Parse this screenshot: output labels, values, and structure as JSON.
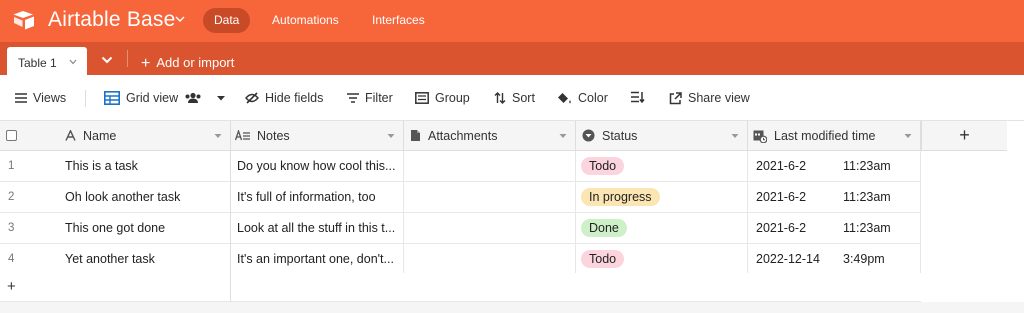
{
  "app": {
    "base_title": "Airtable Base",
    "brand_color": "#f7653b",
    "nav": [
      {
        "label": "Data",
        "active": true
      },
      {
        "label": "Automations",
        "active": false
      },
      {
        "label": "Interfaces",
        "active": false
      }
    ]
  },
  "tables": {
    "active_table": "Table 1",
    "add_label": "Add or import"
  },
  "toolbar": {
    "views": "Views",
    "grid_view": "Grid view",
    "hide_fields": "Hide fields",
    "filter": "Filter",
    "group": "Group",
    "sort": "Sort",
    "color": "Color",
    "share_view": "Share view"
  },
  "grid": {
    "columns": [
      {
        "label": "Name",
        "icon": "text-a-icon"
      },
      {
        "label": "Notes",
        "icon": "long-text-icon"
      },
      {
        "label": "Attachments",
        "icon": "attachment-icon"
      },
      {
        "label": "Status",
        "icon": "single-select-icon"
      },
      {
        "label": "Last modified time",
        "icon": "calendar-time-icon"
      }
    ],
    "add_column": "+",
    "add_row": "+",
    "rows": [
      {
        "num": "1",
        "name": "This is a task",
        "notes": "Do you know how cool this...",
        "attachments": "",
        "status": "Todo",
        "status_color": "#fbd4de",
        "date": "2021-6-2",
        "time": "11:23am"
      },
      {
        "num": "2",
        "name": "Oh look another task",
        "notes": "It's full of information, too",
        "attachments": "",
        "status": "In progress",
        "status_color": "#fbe5b3",
        "date": "2021-6-2",
        "time": "11:23am"
      },
      {
        "num": "3",
        "name": "This one got done",
        "notes": "Look at all the stuff in this t...",
        "attachments": "",
        "status": "Done",
        "status_color": "#cdf0c8",
        "date": "2021-6-2",
        "time": "11:23am"
      },
      {
        "num": "4",
        "name": "Yet another task",
        "notes": "It's an important one, don't...",
        "attachments": "",
        "status": "Todo",
        "status_color": "#fbd4de",
        "date": "2022-12-14",
        "time": "3:49pm"
      }
    ]
  }
}
